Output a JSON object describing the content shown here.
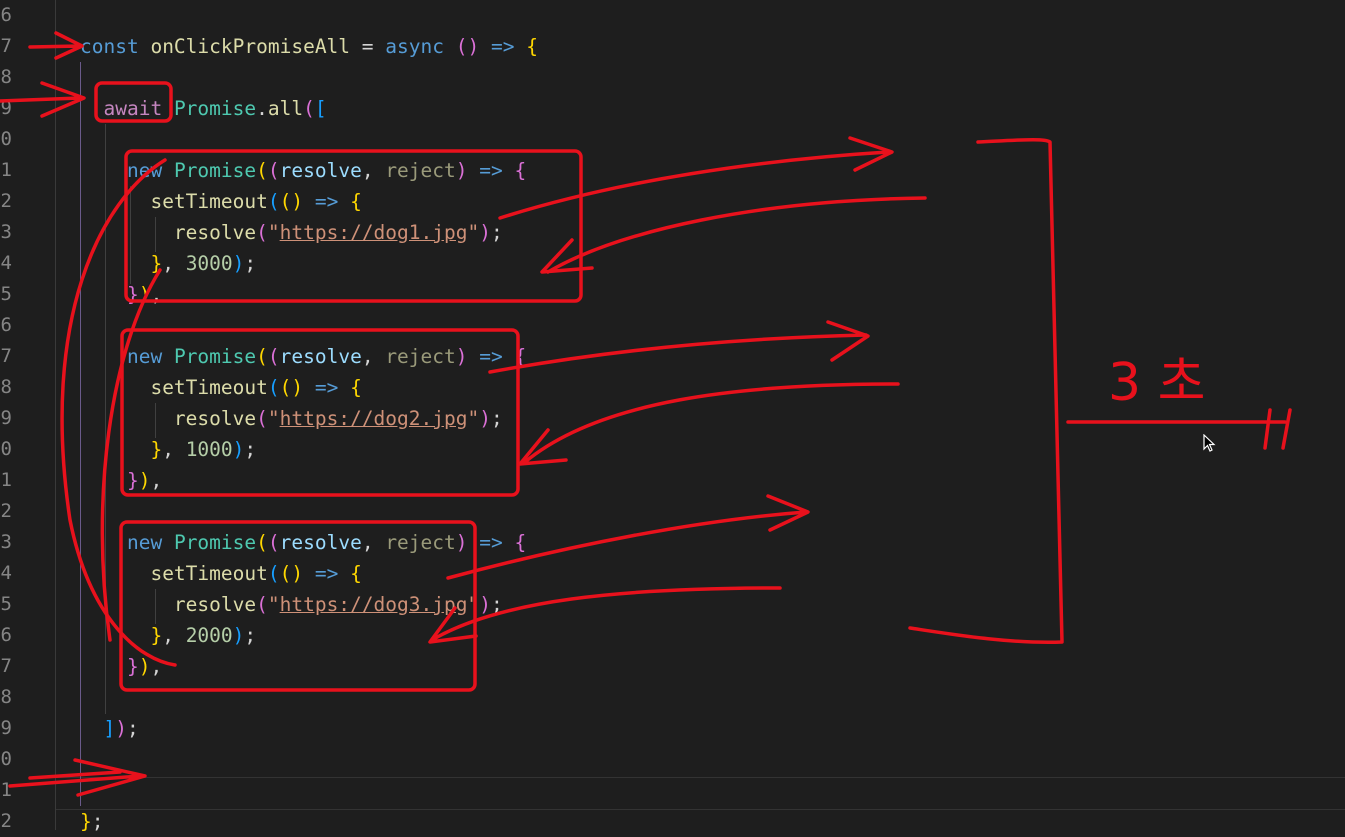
{
  "editor": {
    "gutter": [
      "6",
      "7",
      "8",
      "9",
      "0",
      "1",
      "2",
      "3",
      "4",
      "5",
      "6",
      "7",
      "8",
      "9",
      "0",
      "1",
      "2",
      "3",
      "4",
      "5",
      "6",
      "7",
      "8",
      "9",
      "0",
      "1",
      "2"
    ],
    "code": [
      {
        "indent": 0,
        "tokens": []
      },
      {
        "indent": 0,
        "tokens": [
          [
            "kw",
            "const"
          ],
          [
            "pl",
            " "
          ],
          [
            "fn",
            "onClickPromiseAll"
          ],
          [
            "pl",
            " = "
          ],
          [
            "kw",
            "async"
          ],
          [
            "pl",
            " "
          ],
          [
            "b2",
            "()"
          ],
          [
            "pl",
            " "
          ],
          [
            "kw",
            "=>"
          ],
          [
            "pl",
            " "
          ],
          [
            "b1",
            "{"
          ]
        ]
      },
      {
        "indent": 0,
        "tokens": []
      },
      {
        "indent": 1,
        "tokens": [
          [
            "pl",
            "  "
          ],
          [
            "ctl",
            "await"
          ],
          [
            "pl",
            " "
          ],
          [
            "cls",
            "Promise"
          ],
          [
            "pl",
            "."
          ],
          [
            "fn",
            "all"
          ],
          [
            "b2",
            "("
          ],
          [
            "b3",
            "["
          ]
        ]
      },
      {
        "indent": 0,
        "tokens": []
      },
      {
        "indent": 2,
        "tokens": [
          [
            "pl",
            "    "
          ],
          [
            "kw",
            "new"
          ],
          [
            "pl",
            " "
          ],
          [
            "cls",
            "Promise"
          ],
          [
            "b1",
            "("
          ],
          [
            "b2",
            "("
          ],
          [
            "var",
            "resolve"
          ],
          [
            "pl",
            ", "
          ],
          [
            "dim",
            "reject"
          ],
          [
            "b2",
            ")"
          ],
          [
            "pl",
            " "
          ],
          [
            "kw",
            "=>"
          ],
          [
            "pl",
            " "
          ],
          [
            "b2",
            "{"
          ]
        ]
      },
      {
        "indent": 3,
        "tokens": [
          [
            "pl",
            "      "
          ],
          [
            "fn",
            "setTimeout"
          ],
          [
            "b3",
            "("
          ],
          [
            "b1",
            "()"
          ],
          [
            "pl",
            " "
          ],
          [
            "kw",
            "=>"
          ],
          [
            "pl",
            " "
          ],
          [
            "b1",
            "{"
          ]
        ]
      },
      {
        "indent": 4,
        "tokens": [
          [
            "pl",
            "        "
          ],
          [
            "fn",
            "resolve"
          ],
          [
            "b2",
            "("
          ],
          [
            "str",
            "\""
          ],
          [
            "url",
            "https://dog1.jpg"
          ],
          [
            "str",
            "\""
          ],
          [
            "b2",
            ")"
          ],
          [
            "pl",
            ";"
          ]
        ]
      },
      {
        "indent": 3,
        "tokens": [
          [
            "pl",
            "      "
          ],
          [
            "b1",
            "}"
          ],
          [
            "pl",
            ", "
          ],
          [
            "num",
            "3000"
          ],
          [
            "b3",
            ")"
          ],
          [
            "pl",
            ";"
          ]
        ]
      },
      {
        "indent": 2,
        "tokens": [
          [
            "pl",
            "    "
          ],
          [
            "b2",
            "}"
          ],
          [
            "b1",
            ")"
          ],
          [
            "pl",
            ","
          ]
        ]
      },
      {
        "indent": 0,
        "tokens": []
      },
      {
        "indent": 2,
        "tokens": [
          [
            "pl",
            "    "
          ],
          [
            "kw",
            "new"
          ],
          [
            "pl",
            " "
          ],
          [
            "cls",
            "Promise"
          ],
          [
            "b1",
            "("
          ],
          [
            "b2",
            "("
          ],
          [
            "var",
            "resolve"
          ],
          [
            "pl",
            ", "
          ],
          [
            "dim",
            "reject"
          ],
          [
            "b2",
            ")"
          ],
          [
            "pl",
            " "
          ],
          [
            "kw",
            "=>"
          ],
          [
            "pl",
            " "
          ],
          [
            "b2",
            "{"
          ]
        ]
      },
      {
        "indent": 3,
        "tokens": [
          [
            "pl",
            "      "
          ],
          [
            "fn",
            "setTimeout"
          ],
          [
            "b3",
            "("
          ],
          [
            "b1",
            "()"
          ],
          [
            "pl",
            " "
          ],
          [
            "kw",
            "=>"
          ],
          [
            "pl",
            " "
          ],
          [
            "b1",
            "{"
          ]
        ]
      },
      {
        "indent": 4,
        "tokens": [
          [
            "pl",
            "        "
          ],
          [
            "fn",
            "resolve"
          ],
          [
            "b2",
            "("
          ],
          [
            "str",
            "\""
          ],
          [
            "url",
            "https://dog2.jpg"
          ],
          [
            "str",
            "\""
          ],
          [
            "b2",
            ")"
          ],
          [
            "pl",
            ";"
          ]
        ]
      },
      {
        "indent": 3,
        "tokens": [
          [
            "pl",
            "      "
          ],
          [
            "b1",
            "}"
          ],
          [
            "pl",
            ", "
          ],
          [
            "num",
            "1000"
          ],
          [
            "b3",
            ")"
          ],
          [
            "pl",
            ";"
          ]
        ]
      },
      {
        "indent": 2,
        "tokens": [
          [
            "pl",
            "    "
          ],
          [
            "b2",
            "}"
          ],
          [
            "b1",
            ")"
          ],
          [
            "pl",
            ","
          ]
        ]
      },
      {
        "indent": 0,
        "tokens": []
      },
      {
        "indent": 2,
        "tokens": [
          [
            "pl",
            "    "
          ],
          [
            "kw",
            "new"
          ],
          [
            "pl",
            " "
          ],
          [
            "cls",
            "Promise"
          ],
          [
            "b1",
            "("
          ],
          [
            "b2",
            "("
          ],
          [
            "var",
            "resolve"
          ],
          [
            "pl",
            ", "
          ],
          [
            "dim",
            "reject"
          ],
          [
            "b2",
            ")"
          ],
          [
            "pl",
            " "
          ],
          [
            "kw",
            "=>"
          ],
          [
            "pl",
            " "
          ],
          [
            "b2",
            "{"
          ]
        ]
      },
      {
        "indent": 3,
        "tokens": [
          [
            "pl",
            "      "
          ],
          [
            "fn",
            "setTimeout"
          ],
          [
            "b3",
            "("
          ],
          [
            "b1",
            "()"
          ],
          [
            "pl",
            " "
          ],
          [
            "kw",
            "=>"
          ],
          [
            "pl",
            " "
          ],
          [
            "b1",
            "{"
          ]
        ]
      },
      {
        "indent": 4,
        "tokens": [
          [
            "pl",
            "        "
          ],
          [
            "fn",
            "resolve"
          ],
          [
            "b2",
            "("
          ],
          [
            "str",
            "\""
          ],
          [
            "url",
            "https://dog3.jpg"
          ],
          [
            "str",
            "\""
          ],
          [
            "b2",
            ")"
          ],
          [
            "pl",
            ";"
          ]
        ]
      },
      {
        "indent": 3,
        "tokens": [
          [
            "pl",
            "      "
          ],
          [
            "b1",
            "}"
          ],
          [
            "pl",
            ", "
          ],
          [
            "num",
            "2000"
          ],
          [
            "b3",
            ")"
          ],
          [
            "pl",
            ";"
          ]
        ]
      },
      {
        "indent": 2,
        "tokens": [
          [
            "pl",
            "    "
          ],
          [
            "b2",
            "}"
          ],
          [
            "b1",
            ")"
          ],
          [
            "pl",
            ","
          ]
        ]
      },
      {
        "indent": 0,
        "tokens": []
      },
      {
        "indent": 1,
        "tokens": [
          [
            "pl",
            "  "
          ],
          [
            "b3",
            "]"
          ],
          [
            "b2",
            ")"
          ],
          [
            "pl",
            ";"
          ]
        ]
      },
      {
        "indent": 0,
        "tokens": []
      },
      {
        "indent": 0,
        "tokens": []
      },
      {
        "indent": 0,
        "tokens": [
          [
            "b1",
            "}"
          ],
          [
            "pl",
            ";"
          ]
        ]
      }
    ]
  },
  "annotation": {
    "label": "3 초",
    "color": "#e8111c"
  },
  "colors": {
    "kw": "#569cd6",
    "ctl": "#c586c0",
    "fn": "#dcdcaa",
    "cls": "#4ec9b0",
    "var": "#9cdcfe",
    "dim": "#9a9a7a",
    "str": "#ce9178",
    "url": "#ce9178",
    "num": "#b5cea8",
    "pl": "#d4d4d4",
    "b1": "#ffd700",
    "b2": "#da70d6",
    "b3": "#179fff"
  }
}
